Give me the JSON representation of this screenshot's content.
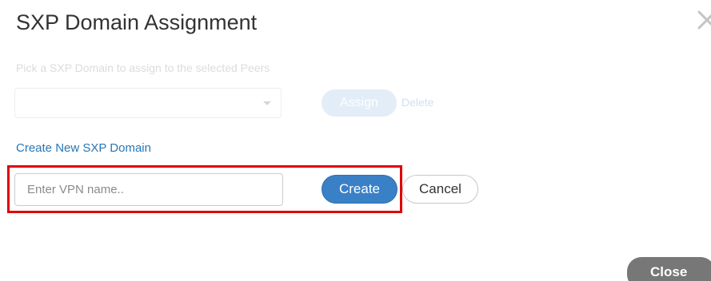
{
  "dialog": {
    "title": "SXP Domain Assignment",
    "close_icon": "close-icon"
  },
  "assign_section": {
    "instruction": "Pick a SXP Domain to assign to the selected Peers",
    "select_value": "",
    "caret_icon": "chevron-down-icon",
    "assign_label": "Assign",
    "delete_label": "Delete"
  },
  "create_section": {
    "link_label": "Create New SXP Domain",
    "input_value": "",
    "input_placeholder": "Enter VPN name..",
    "create_label": "Create",
    "cancel_label": "Cancel",
    "highlight_color": "#e00000"
  },
  "footer": {
    "close_label": "Close"
  },
  "colors": {
    "primary_button": "#3a80c7",
    "link": "#2777b6",
    "footer_button": "#777777"
  }
}
